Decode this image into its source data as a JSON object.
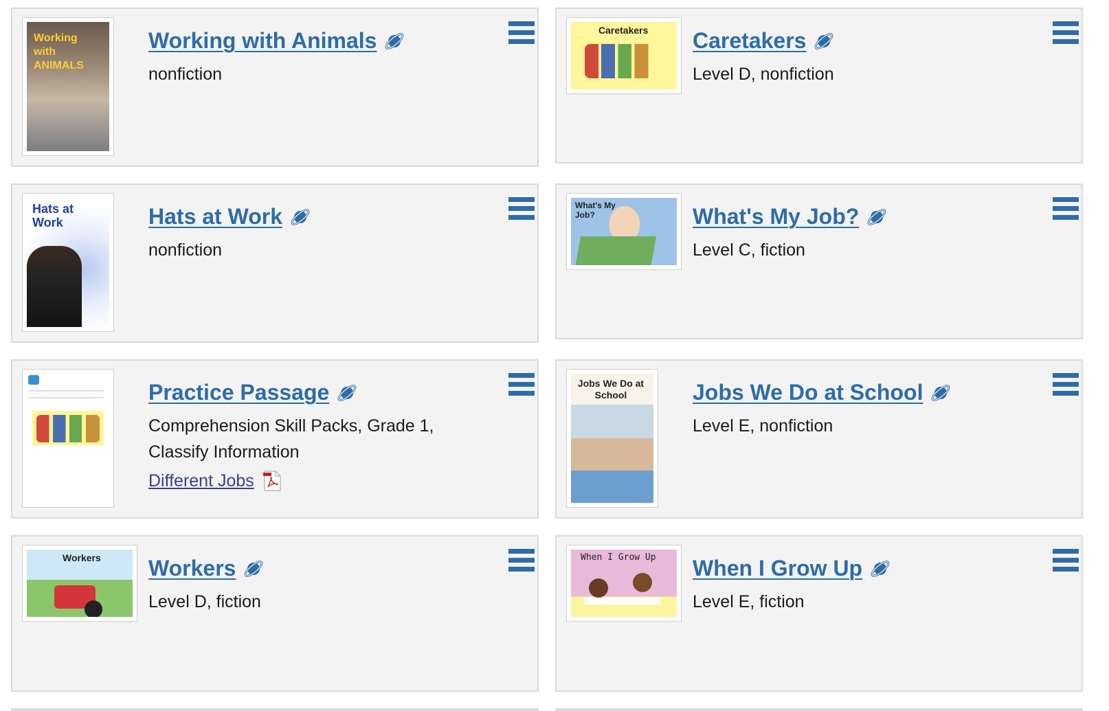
{
  "cards": [
    {
      "title": "Working with Animals",
      "desc": "nonfiction",
      "cover": "book-cover",
      "cover_text": "Working with ANIMALS"
    },
    {
      "title": "Caretakers",
      "desc": "Level D, nonfiction",
      "cover": "book-cover",
      "cover_text": "Caretakers"
    },
    {
      "title": "Hats at Work",
      "desc": "nonfiction",
      "cover": "book-cover",
      "cover_text": "Hats at Work"
    },
    {
      "title": "What's My Job?",
      "desc": "Level C, fiction",
      "cover": "book-cover",
      "cover_text": "What's My Job?"
    },
    {
      "title": "Practice Passage",
      "desc_line1": "Comprehension Skill Packs, Grade 1,",
      "desc_line2": "Classify Information",
      "link": "Different Jobs",
      "cover": "worksheet-cover"
    },
    {
      "title": "Jobs We Do at School",
      "desc": "Level E, nonfiction",
      "cover": "book-cover",
      "cover_text": "Jobs We Do at School"
    },
    {
      "title": "Workers",
      "desc": "Level D, fiction",
      "cover": "book-cover",
      "cover_text": "Workers"
    },
    {
      "title": "When I Grow Up",
      "desc": "Level E, fiction",
      "cover": "book-cover",
      "cover_text": "When I Grow Up"
    }
  ],
  "icons": {
    "title_icon": "planet-icon",
    "menu": "hamburger-menu-icon",
    "file": "pdf-icon"
  },
  "colors": {
    "link": "#2e6ca6",
    "card_bg": "#f3f3f3",
    "border": "#dadada",
    "sub_link": "#3a3f8f"
  }
}
